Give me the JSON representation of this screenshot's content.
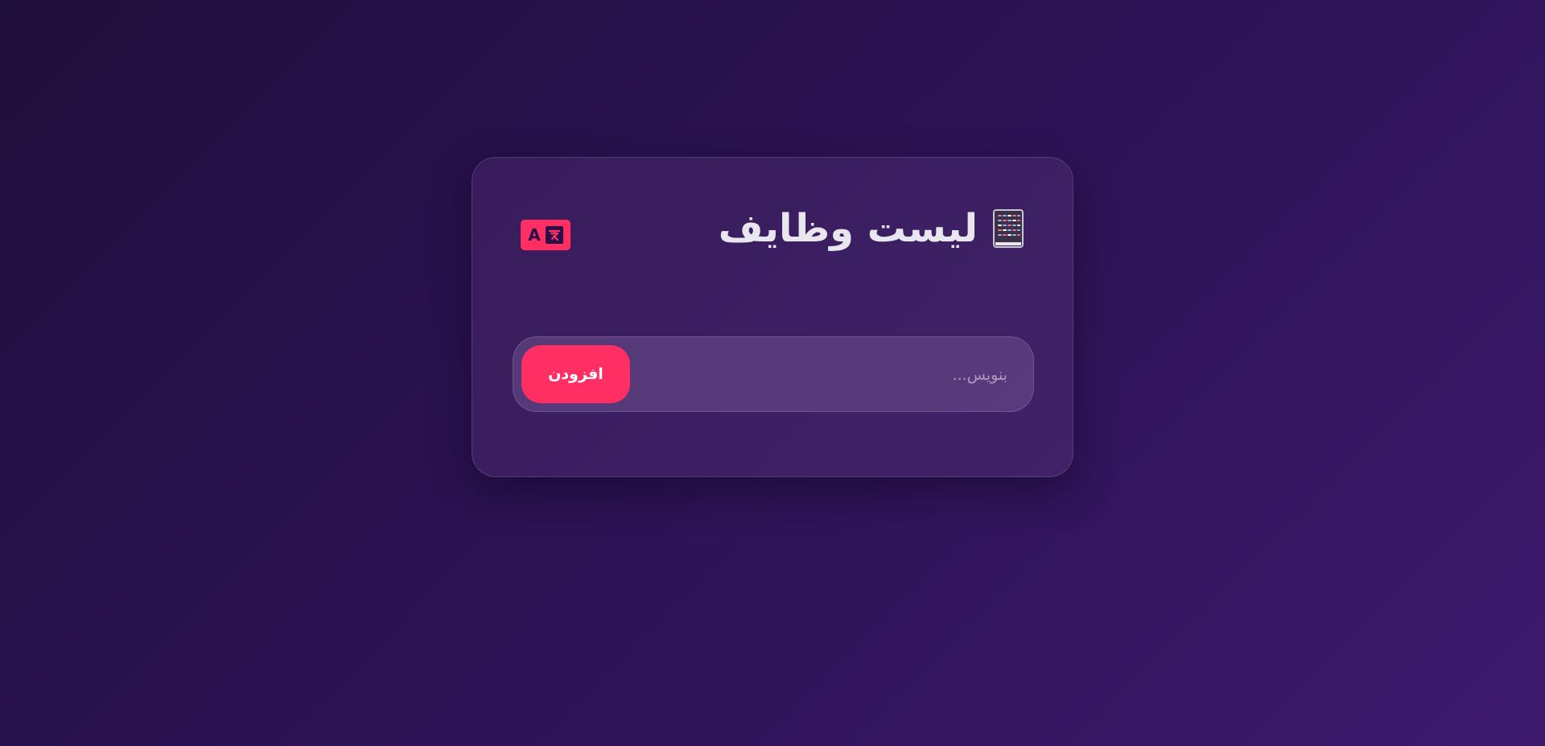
{
  "app": {
    "title": "لیست وظایف",
    "title_icon": "notebook-icon"
  },
  "language_toggle": {
    "icon": "translate-icon",
    "letter": "A",
    "glyph": "文"
  },
  "task_form": {
    "input_value": "",
    "input_placeholder": "بنویس...",
    "add_label": "افزودن"
  },
  "colors": {
    "accent": "#ff2e63",
    "background_start": "#1f0f3b",
    "background_end": "#3d1a6e",
    "title_text": "#e8e6ee",
    "button_text": "#ffffff"
  }
}
